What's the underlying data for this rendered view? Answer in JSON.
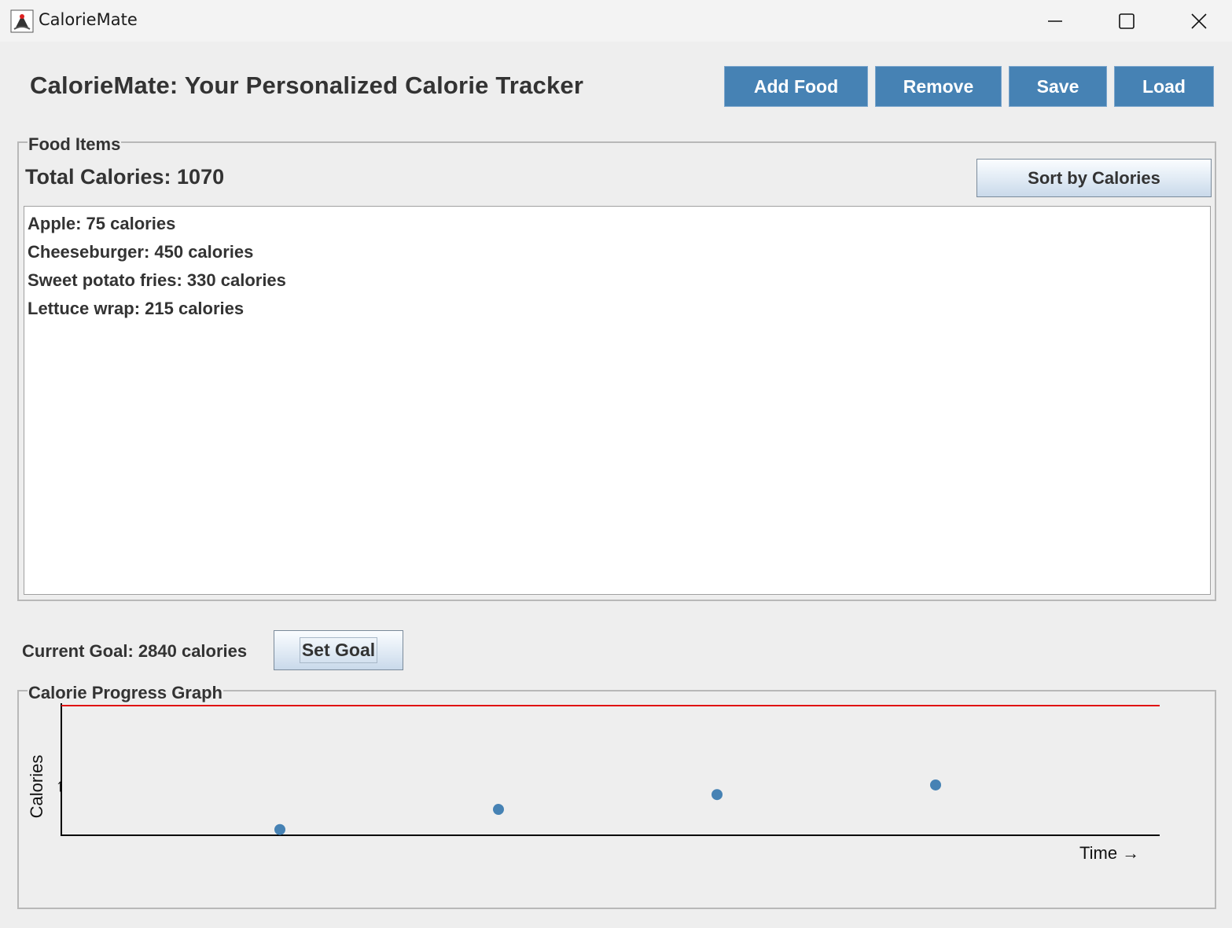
{
  "window": {
    "title": "CalorieMate",
    "icon": "java-duke-icon"
  },
  "header": {
    "title": "CalorieMate: Your Personalized Calorie Tracker",
    "buttons": {
      "add_food": "Add Food",
      "remove": "Remove",
      "save": "Save",
      "load": "Load"
    },
    "button_color": "#4682b4"
  },
  "food_panel": {
    "title": "Food Items",
    "total_calories_label": "Total Calories: 1070",
    "sort_button": "Sort by Calories",
    "items": [
      "Apple: 75 calories",
      "Cheeseburger: 450 calories",
      "Sweet potato fries: 330 calories",
      "Lettuce wrap: 215 calories"
    ]
  },
  "goal": {
    "label": "Current Goal: 2840 calories",
    "set_goal_button": "Set Goal"
  },
  "graph": {
    "title": "Calorie Progress Graph",
    "xlabel": "Time →",
    "ylabel": "Calories →",
    "goal_line_color": "#e01010",
    "point_color": "#4682b4"
  },
  "chart_data": {
    "type": "scatter",
    "xlabel": "Time →",
    "ylabel": "Calories →",
    "goal": 2840,
    "x": [
      1,
      2,
      3,
      4
    ],
    "values": [
      75,
      525,
      855,
      1070
    ],
    "ylim": [
      0,
      2840
    ],
    "grid": false
  }
}
